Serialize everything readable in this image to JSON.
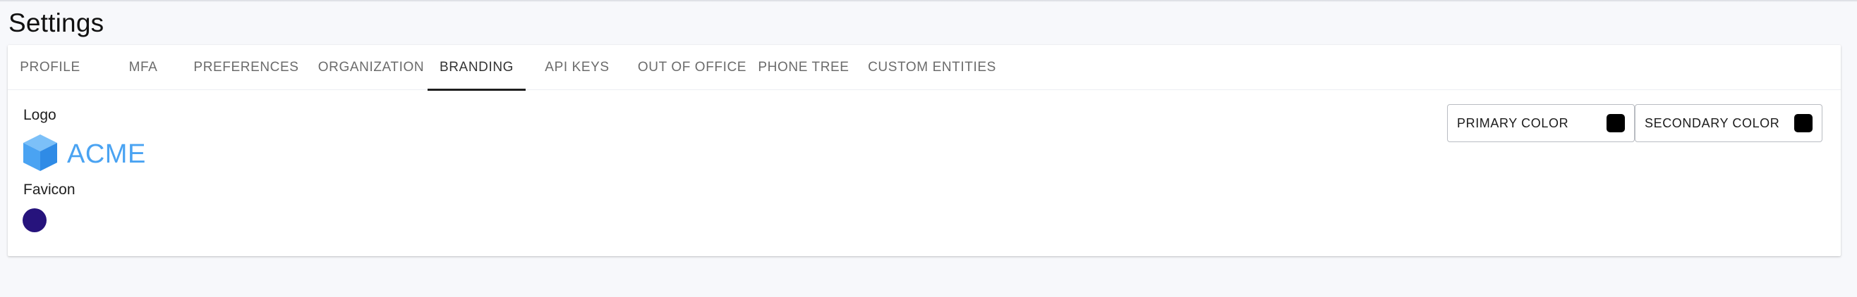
{
  "page": {
    "title": "Settings"
  },
  "tabs": [
    {
      "label": "PROFILE",
      "active": false
    },
    {
      "label": "MFA",
      "active": false
    },
    {
      "label": "PREFERENCES",
      "active": false
    },
    {
      "label": "ORGANIZATION",
      "active": false
    },
    {
      "label": "BRANDING",
      "active": true
    },
    {
      "label": "API KEYS",
      "active": false
    },
    {
      "label": "OUT OF OFFICE",
      "active": false
    },
    {
      "label": "PHONE TREE",
      "active": false
    },
    {
      "label": "CUSTOM ENTITIES",
      "active": false
    }
  ],
  "branding": {
    "logo_label": "Logo",
    "logo_text": "ACME",
    "logo_icon": "cube-icon",
    "logo_color": "#4aa3f2",
    "favicon_label": "Favicon",
    "favicon_color": "#26137c",
    "primary_color": {
      "label": "PRIMARY COLOR",
      "value": "#000000"
    },
    "secondary_color": {
      "label": "SECONDARY COLOR",
      "value": "#000000"
    }
  }
}
